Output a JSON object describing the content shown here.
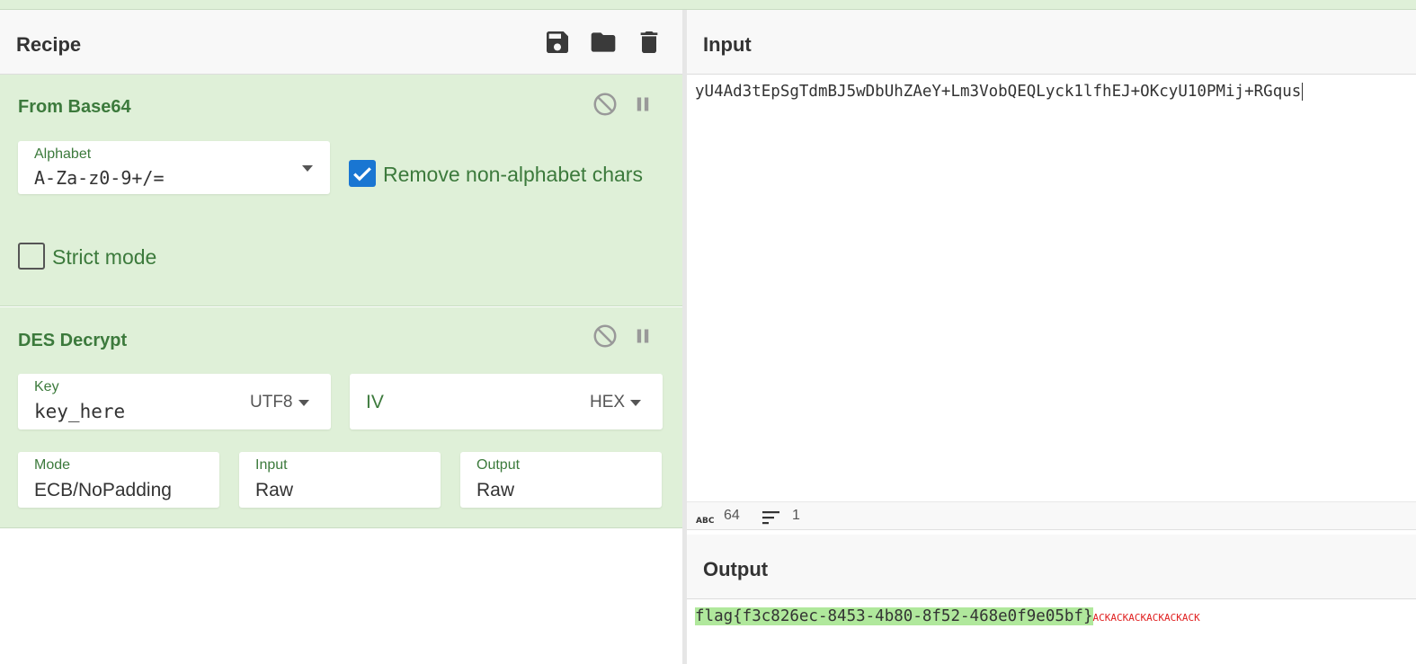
{
  "recipe": {
    "title": "Recipe",
    "icons": {
      "save": "save-icon",
      "load": "folder-icon",
      "clear": "trash-icon"
    },
    "operations": [
      {
        "name": "From Base64",
        "alphabet_label": "Alphabet",
        "alphabet_value": "A-Za-z0-9+/=",
        "remove_nonalpha_label": "Remove non-alphabet chars",
        "remove_nonalpha_checked": true,
        "strict_mode_label": "Strict mode",
        "strict_mode_checked": false
      },
      {
        "name": "DES Decrypt",
        "key_label": "Key",
        "key_value": "key_here",
        "key_encoding": "UTF8",
        "iv_placeholder": "IV",
        "iv_encoding": "HEX",
        "mode_label": "Mode",
        "mode_value": "ECB/NoPadding",
        "input_label": "Input",
        "input_value": "Raw",
        "output_label": "Output",
        "output_value": "Raw"
      }
    ]
  },
  "input": {
    "title": "Input",
    "text": "yU4Ad3tEpSgTdmBJ5wDbUhZAeY+Lm3VobQEQLyck1lfhEJ+OKcyU10PMij+RGqus",
    "stats": {
      "length": "64",
      "lines": "1"
    }
  },
  "output": {
    "title": "Output",
    "highlighted": "flag{f3c826ec-8453-4b80-8f52-468e0f9e05bf}",
    "tail": "ACKACKACKACKACKACK"
  },
  "colors": {
    "op_background": "#dff0d8",
    "op_text": "#3c7a3c",
    "checkbox": "#1976d2",
    "output_highlight": "#b0e89c",
    "output_tail": "#e02020"
  }
}
